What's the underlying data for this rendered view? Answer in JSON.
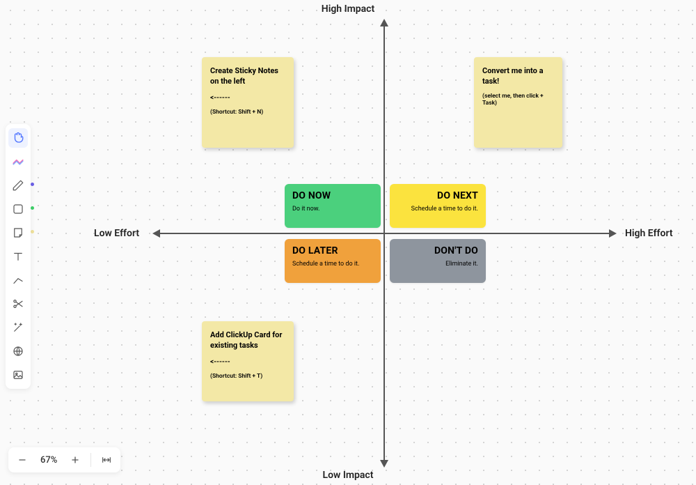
{
  "axes": {
    "top": "High Impact",
    "bottom": "Low Impact",
    "left": "Low Effort",
    "right": "High Effort"
  },
  "quadrants": {
    "doNow": {
      "title": "DO NOW",
      "sub": "Do it now."
    },
    "doNext": {
      "title": "DO NEXT",
      "sub": "Schedule a time to do it."
    },
    "doLater": {
      "title": "DO LATER",
      "sub": "Schedule a time to do it."
    },
    "dontDo": {
      "title": "DON'T DO",
      "sub": "Eliminate it."
    }
  },
  "stickies": {
    "left1": {
      "title": "Create Sticky Notes on the left",
      "arrow": "<------",
      "sub": "(Shortcut: Shift + N)"
    },
    "left2": {
      "title": "Add ClickUp Card for existing tasks",
      "arrow": "<------",
      "sub": "(Shortcut: Shift + T)"
    },
    "right1": {
      "title": "Convert me into a task!",
      "sub": "(select me, then click + Task)"
    }
  },
  "toolbar": {
    "items": {
      "hand": "hand-icon",
      "zigzag": "zigzag-icon",
      "pen": "pen-icon",
      "shape": "shape-icon",
      "note": "note-icon",
      "text": "text-icon",
      "line": "line-icon",
      "cut": "scissors-icon",
      "magic": "magic-icon",
      "globe": "globe-icon",
      "image": "image-icon"
    },
    "dotColors": {
      "pen": "#6b5fe8",
      "shape": "#3dd069",
      "note": "#f0e29b"
    }
  },
  "zoom": {
    "level": "67%"
  },
  "colors": {
    "doNow": "#4bd07d",
    "doNext": "#fbe33e",
    "doLater": "#f0a13c",
    "dontDo": "#8e959e",
    "sticky": "#f3e8a6"
  }
}
